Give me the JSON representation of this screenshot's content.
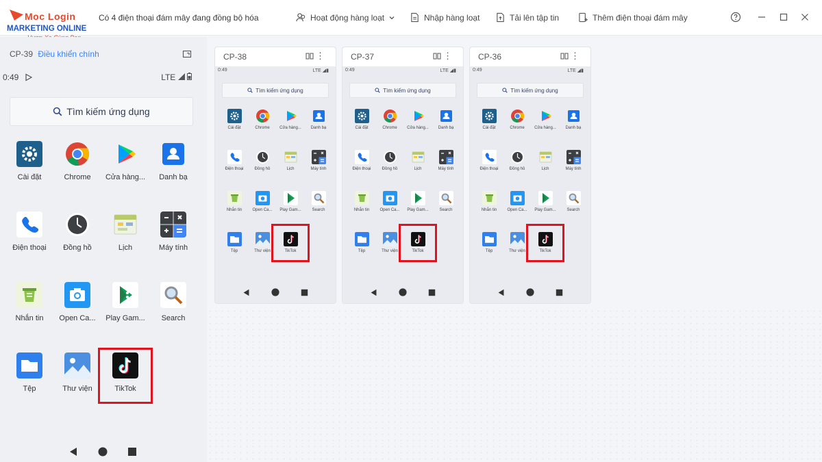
{
  "brand": {
    "top": "Moc Login",
    "main": "MARKETING ONLINE",
    "sub": "Vươn Xa Cùng Bạn"
  },
  "header": {
    "sync_status": "Có 4 điện thoại đám mây đang đồng bộ hóa",
    "actions": [
      {
        "label": "Hoạt động hàng loạt",
        "icon": "users-icon"
      },
      {
        "label": "Nhập hàng loạt",
        "icon": "document-icon"
      },
      {
        "label": "Tải lên tập tin",
        "icon": "upload-file-icon"
      },
      {
        "label": "Thêm điện thoại đám mây",
        "icon": "add-phone-icon"
      }
    ]
  },
  "main_phone": {
    "id": "CP-39",
    "role": "Điều khiển chính",
    "time": "0:49",
    "network": "LTE",
    "search_placeholder": "Tìm kiếm ứng dụng",
    "apps": [
      {
        "label": "Cài đặt",
        "icon": "settings-icon"
      },
      {
        "label": "Chrome",
        "icon": "chrome-icon"
      },
      {
        "label": "Cửa hàng...",
        "icon": "play-store-icon"
      },
      {
        "label": "Danh bạ",
        "icon": "contacts-icon"
      },
      {
        "label": "Điện thoại",
        "icon": "phone-icon"
      },
      {
        "label": "Đồng hồ",
        "icon": "clock-icon"
      },
      {
        "label": "Lịch",
        "icon": "calendar-icon"
      },
      {
        "label": "Máy tính",
        "icon": "calculator-icon"
      },
      {
        "label": "Nhắn tin",
        "icon": "messages-icon"
      },
      {
        "label": "Open Ca...",
        "icon": "camera-icon"
      },
      {
        "label": "Play Gam...",
        "icon": "play-games-icon"
      },
      {
        "label": "Search",
        "icon": "search-icon"
      },
      {
        "label": "Tệp",
        "icon": "files-icon"
      },
      {
        "label": "Thư viện",
        "icon": "gallery-icon"
      },
      {
        "label": "TikTok",
        "icon": "tiktok-icon"
      }
    ]
  },
  "phones": [
    {
      "id": "CP-38",
      "time": "0:49",
      "network": "LTE"
    },
    {
      "id": "CP-37",
      "time": "0:49",
      "network": "LTE"
    },
    {
      "id": "CP-36",
      "time": "0:49",
      "network": "LTE"
    }
  ],
  "small_apps": [
    "Cài đặt",
    "Chrome",
    "Cửa hàng...",
    "Danh bạ",
    "Điện thoại",
    "Đồng hồ",
    "Lịch",
    "Máy tính",
    "Nhắn tin",
    "Open Ca...",
    "Play Gam...",
    "Search",
    "Tệp",
    "Thư viện",
    "TikTok"
  ],
  "colors": {
    "highlight": "#e0141e",
    "accent": "#3b82f6",
    "brand_red": "#e8482c",
    "brand_blue": "#1e56c9"
  }
}
